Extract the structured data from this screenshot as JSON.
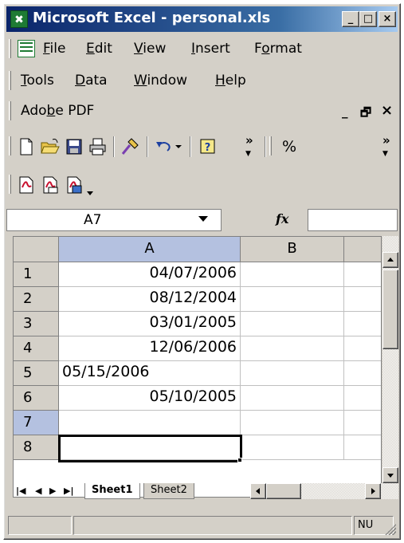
{
  "window": {
    "title": "Microsoft Excel - personal.xls",
    "controls": {
      "minimize": "_",
      "restore": "□",
      "close": "×"
    }
  },
  "menubar": {
    "row1": [
      {
        "label": "File",
        "ul": "F",
        "rest": "ile"
      },
      {
        "label": "Edit",
        "ul": "E",
        "rest": "dit"
      },
      {
        "label": "View",
        "ul": "V",
        "rest": "iew"
      },
      {
        "label": "Insert",
        "ul": "I",
        "rest": "nsert"
      },
      {
        "label": "Format",
        "pre": "F",
        "ul": "o",
        "rest": "rmat"
      }
    ],
    "row2": [
      {
        "label": "Tools",
        "ul": "T",
        "rest": "ools"
      },
      {
        "label": "Data",
        "ul": "D",
        "rest": "ata"
      },
      {
        "label": "Window",
        "ul": "W",
        "rest": "indow"
      },
      {
        "label": "Help",
        "ul": "H",
        "rest": "elp"
      }
    ],
    "row3": {
      "pre": "Ado",
      "ul": "b",
      "rest": "e PDF"
    },
    "doc_controls": {
      "minimize": "_",
      "restore": "🗗",
      "close": "×"
    }
  },
  "toolbar": {
    "icons": [
      "new-document",
      "open-folder",
      "save",
      "print",
      "format-painter",
      "undo",
      "help"
    ],
    "zoom_symbol": "%"
  },
  "pdf_toolbar": {
    "icons": [
      "convert-to-pdf",
      "convert-and-email",
      "convert-and-review"
    ]
  },
  "formula_bar": {
    "name_box": "A7",
    "fx_label": "fx",
    "formula": ""
  },
  "sheet": {
    "columns": [
      "A",
      "B"
    ],
    "rows": [
      {
        "num": "1",
        "a": "04/07/2006",
        "align": "right"
      },
      {
        "num": "2",
        "a": "08/12/2004",
        "align": "right"
      },
      {
        "num": "3",
        "a": "03/01/2005",
        "align": "right"
      },
      {
        "num": "4",
        "a": "12/06/2006",
        "align": "right"
      },
      {
        "num": "5",
        "a": "05/15/2006",
        "align": "left"
      },
      {
        "num": "6",
        "a": "05/10/2005",
        "align": "right"
      },
      {
        "num": "7",
        "a": "",
        "align": "left"
      },
      {
        "num": "8",
        "a": "",
        "align": "left"
      }
    ],
    "active_cell": "A7",
    "tabs": [
      "Sheet1",
      "Sheet2"
    ],
    "active_tab": "Sheet1"
  },
  "statusbar": {
    "indicator": "NU"
  },
  "colors": {
    "title_gradient_start": "#0a246a",
    "title_gradient_end": "#a6caf0",
    "chrome": "#d4d0c8",
    "selected_header": "#b4c1e0",
    "excel_green": "#1e7b34"
  }
}
